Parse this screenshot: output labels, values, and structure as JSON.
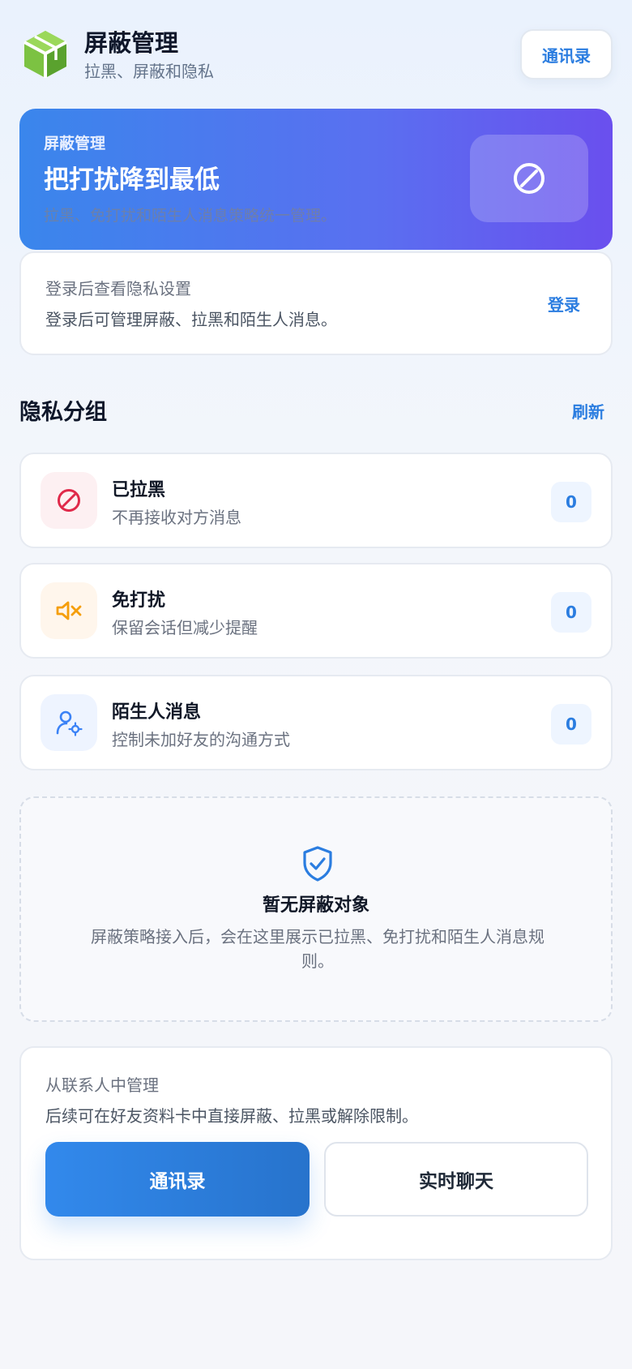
{
  "header": {
    "title": "屏蔽管理",
    "subtitle": "拉黑、屏蔽和隐私",
    "contacts_label": "通讯录",
    "logo_icon": "green-cube-icon"
  },
  "hero": {
    "eyebrow": "屏蔽管理",
    "title": "把打扰降到最低",
    "description": "拉黑、免打扰和陌生人消息策略统一管理。",
    "icon": "block-icon"
  },
  "login": {
    "title": "登录后查看隐私设置",
    "description": "登录后可管理屏蔽、拉黑和陌生人消息。",
    "action_label": "登录"
  },
  "groups_section": {
    "title": "隐私分组",
    "refresh_label": "刷新",
    "items": [
      {
        "title": "已拉黑",
        "description": "不再接收对方消息",
        "count": "0",
        "icon": "block-icon",
        "color": "#e0294a",
        "bg": "#fdf0f2"
      },
      {
        "title": "免打扰",
        "description": "保留会话但减少提醒",
        "count": "0",
        "icon": "mute-icon",
        "color": "#f59e0b",
        "bg": "#fff6ec"
      },
      {
        "title": "陌生人消息",
        "description": "控制未加好友的沟通方式",
        "count": "0",
        "icon": "user-settings-icon",
        "color": "#3b82f6",
        "bg": "#eef4ff"
      }
    ]
  },
  "empty_state": {
    "icon": "shield-check-icon",
    "title": "暂无屏蔽对象",
    "description": "屏蔽策略接入后，会在这里展示已拉黑、免打扰和陌生人消息规则。"
  },
  "manage": {
    "title": "从联系人中管理",
    "description": "后续可在好友资料卡中直接屏蔽、拉黑或解除限制。",
    "primary_label": "通讯录",
    "secondary_label": "实时聊天"
  },
  "colors": {
    "accent": "#2b7de0",
    "hero_start": "#3a86ec",
    "hero_end": "#6a4fee"
  }
}
